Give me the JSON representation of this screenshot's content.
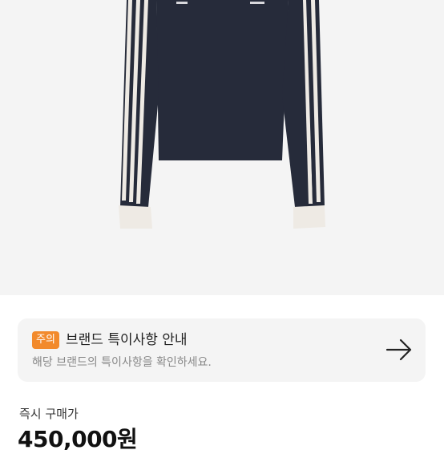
{
  "notice": {
    "badge": "주의",
    "title": "브랜드 특이사항 안내",
    "subtitle": "해당 브랜드의 특이사항을 확인하세요."
  },
  "purchase": {
    "label": "즉시 구매가",
    "price": "450,000원"
  }
}
